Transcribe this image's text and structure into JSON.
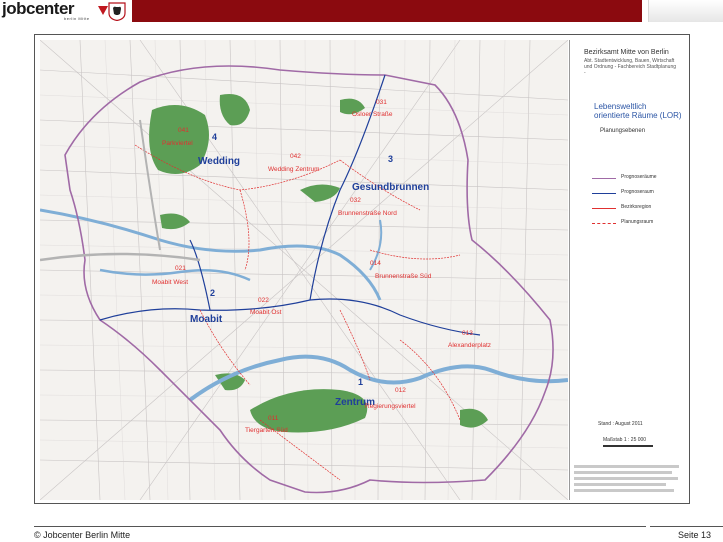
{
  "header": {
    "logo_text": "jobcenter",
    "logo_subtitle": "berlin Mitte",
    "bar_color": "#8b0a0f"
  },
  "legend": {
    "title1": "Bezirksamt Mitte von Berlin",
    "title2": "Abt. Stadtentwicklung, Bauen, Wirtschaft und Ordnung - Fachbereich Stadtplanung -",
    "lor_title": "Lebensweltlich orientierte Räume (LOR)",
    "lor_subtitle": "Planungsebenen",
    "rows": [
      {
        "label": "Prognoseräume",
        "color": "#a06aa6"
      },
      {
        "label": "Prognoseraum",
        "color": "#1f3f9a"
      },
      {
        "label": "Bezirksregion",
        "color": "#e03030"
      },
      {
        "label": "Planungsraum",
        "color": "#e03030"
      }
    ],
    "date": "Stand : August 2011",
    "scale": "Maßstab 1 : 25 000"
  },
  "map": {
    "green_color": "#5c9e55",
    "water_color": "#7faed6",
    "areas": [
      {
        "num": "1",
        "name": "Zentrum"
      },
      {
        "num": "2",
        "name": "Moabit"
      },
      {
        "num": "3",
        "name": "Gesundbrunnen"
      },
      {
        "num": "4",
        "name": "Wedding"
      }
    ],
    "regions": [
      {
        "code": "011",
        "name": "Tiergarten Süd"
      },
      {
        "code": "012",
        "name": "Regierungsviertel"
      },
      {
        "code": "013",
        "name": "Alexanderplatz"
      },
      {
        "code": "014",
        "name": "Brunnenstraße Süd"
      },
      {
        "code": "021",
        "name": "Moabit West"
      },
      {
        "code": "022",
        "name": "Moabit Ost"
      },
      {
        "code": "031",
        "name": "Osloer Straße"
      },
      {
        "code": "032",
        "name": "Brunnenstraße Nord"
      },
      {
        "code": "041",
        "name": "Parkviertel"
      },
      {
        "code": "042",
        "name": "Wedding Zentrum"
      }
    ]
  },
  "footer": {
    "copyright": "© Jobcenter Berlin Mitte",
    "page": "Seite 13"
  }
}
